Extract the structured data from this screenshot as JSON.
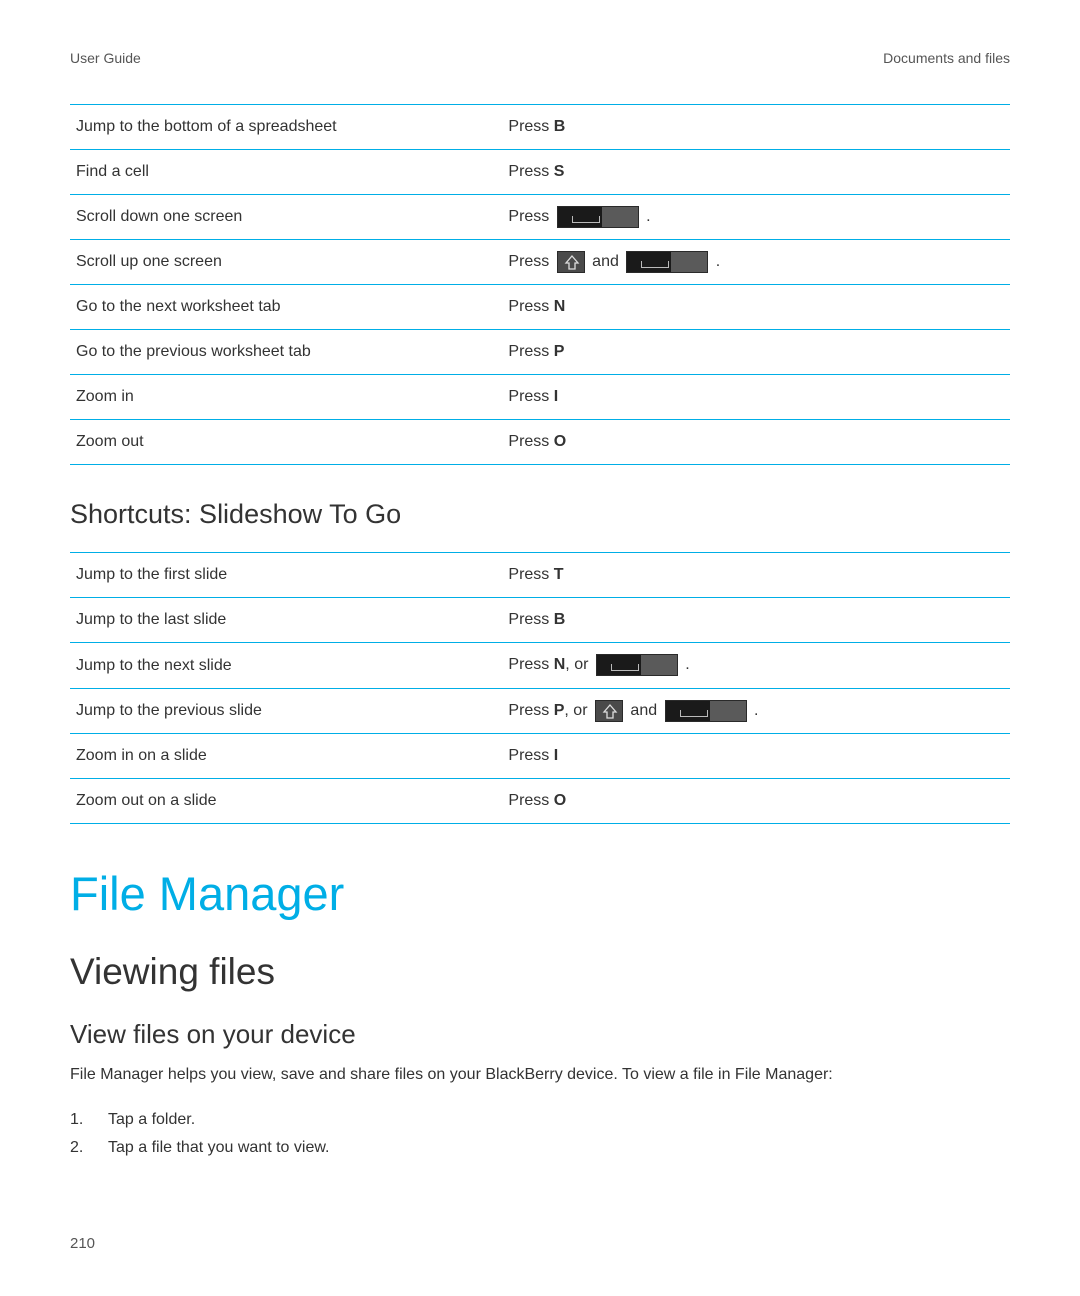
{
  "header": {
    "left": "User Guide",
    "right": "Documents and files"
  },
  "table1": {
    "rows": [
      {
        "action": "Jump to the bottom of a spreadsheet",
        "key_prefix": "Press ",
        "key_bold": "B",
        "icons": []
      },
      {
        "action": "Find a cell",
        "key_prefix": "Press ",
        "key_bold": "S",
        "icons": []
      },
      {
        "action": "Scroll down one screen",
        "key_prefix": "Press ",
        "key_bold": "",
        "icons": [
          "space"
        ],
        "suffix": " ."
      },
      {
        "action": "Scroll up one screen",
        "key_prefix": "Press ",
        "key_bold": "",
        "icons": [
          "shift",
          "and",
          "space"
        ],
        "suffix": " ."
      },
      {
        "action": "Go to the next worksheet tab",
        "key_prefix": "Press ",
        "key_bold": "N",
        "icons": []
      },
      {
        "action": "Go to the previous worksheet tab",
        "key_prefix": "Press ",
        "key_bold": "P",
        "icons": []
      },
      {
        "action": "Zoom in",
        "key_prefix": "Press ",
        "key_bold": "I",
        "icons": []
      },
      {
        "action": "Zoom out",
        "key_prefix": "Press ",
        "key_bold": "O",
        "icons": []
      }
    ]
  },
  "section_heading": "Shortcuts: Slideshow To Go",
  "table2": {
    "rows": [
      {
        "action": "Jump to the first slide",
        "key_prefix": "Press ",
        "key_bold": "T",
        "icons": []
      },
      {
        "action": "Jump to the last slide",
        "key_prefix": "Press ",
        "key_bold": "B",
        "icons": []
      },
      {
        "action": "Jump to the next slide",
        "key_prefix": "Press ",
        "key_bold": "N",
        "mid": ", or ",
        "icons": [
          "space"
        ],
        "suffix": " ."
      },
      {
        "action": "Jump to the previous slide",
        "key_prefix": "Press ",
        "key_bold": "P",
        "mid": ", or ",
        "icons": [
          "shift",
          "and",
          "space"
        ],
        "suffix": " ."
      },
      {
        "action": "Zoom in on a slide",
        "key_prefix": "Press ",
        "key_bold": "I",
        "icons": []
      },
      {
        "action": "Zoom out on a slide",
        "key_prefix": "Press ",
        "key_bold": "O",
        "icons": []
      }
    ]
  },
  "chapter_title": "File Manager",
  "topic_title": "Viewing files",
  "subtopic_title": "View files on your device",
  "body_text": "File Manager helps you view, save and share files on your BlackBerry device. To view a file in File Manager:",
  "steps": [
    "Tap a folder.",
    "Tap a file that you want to view."
  ],
  "page_number": "210"
}
